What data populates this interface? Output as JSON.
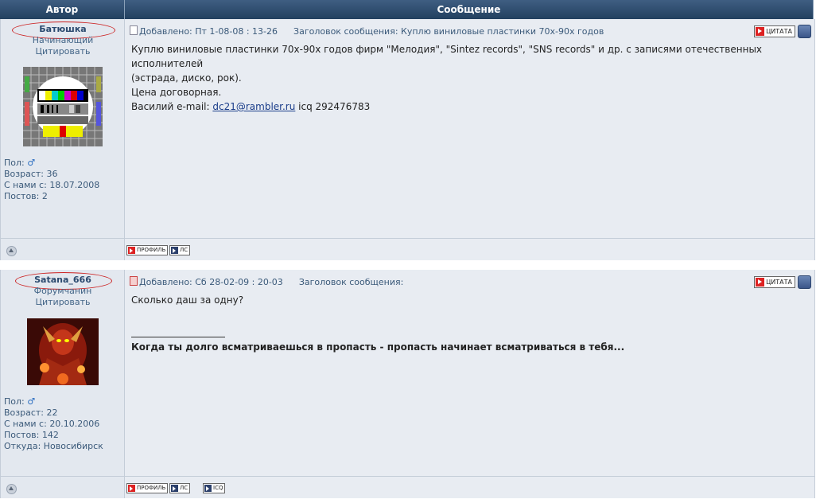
{
  "header": {
    "author_col": "Автор",
    "message_col": "Сообщение"
  },
  "posts": [
    {
      "username": "Батюшка",
      "rank": "Начинающий",
      "quote_link": "Цитировать",
      "gender_label": "Пол:",
      "age_label": "Возраст:",
      "age": "36",
      "since_label": "С нами с:",
      "since": "18.07.2008",
      "posts_label": "Постов:",
      "posts_count": "2",
      "meta_added": "Добавлено: Пт 1-08-08 : 13-26",
      "meta_subject": "Заголовок сообщения: Куплю виниловые пластинки 70х-90х годов",
      "quote_button": "ЦИТАТА",
      "line1": "Куплю виниловые пластинки 70х-90х годов фирм \"Мелодия\", \"Sintez records\", \"SNS records\" и др. с записями отечественных исполнителей",
      "line2": "(эстрада, диско, рок).",
      "line3": "Цена договорная.",
      "line4_prefix": "Василий e-mail: ",
      "email": "dc21@rambler.ru",
      "line4_suffix": " icq 292476783",
      "foot_profile": "ПРОФИЛЬ",
      "foot_pm": "ЛС"
    },
    {
      "username": "Satana_666",
      "rank": "Форумчанин",
      "quote_link": "Цитировать",
      "gender_label": "Пол:",
      "age_label": "Возраст:",
      "age": "22",
      "since_label": "С нами с:",
      "since": "20.10.2006",
      "posts_label": "Постов:",
      "posts_count": "142",
      "from_label": "Откуда:",
      "from": "Новосибирск",
      "meta_added": "Добавлено: Сб 28-02-09 : 20-03",
      "meta_subject": "Заголовок сообщения:",
      "quote_button": "ЦИТАТА",
      "line1": "Сколько даш за одну?",
      "signature": "Когда ты долго всматриваешься в пропасть - пропасть начинает всматриваться в тебя...",
      "foot_profile": "ПРОФИЛЬ",
      "foot_pm": "ЛС",
      "foot_icq": "ICQ"
    }
  ],
  "colors": {
    "header": "#2b4a6f",
    "highlight_oval": "#cc2222",
    "panel": "#e8ecf2"
  }
}
